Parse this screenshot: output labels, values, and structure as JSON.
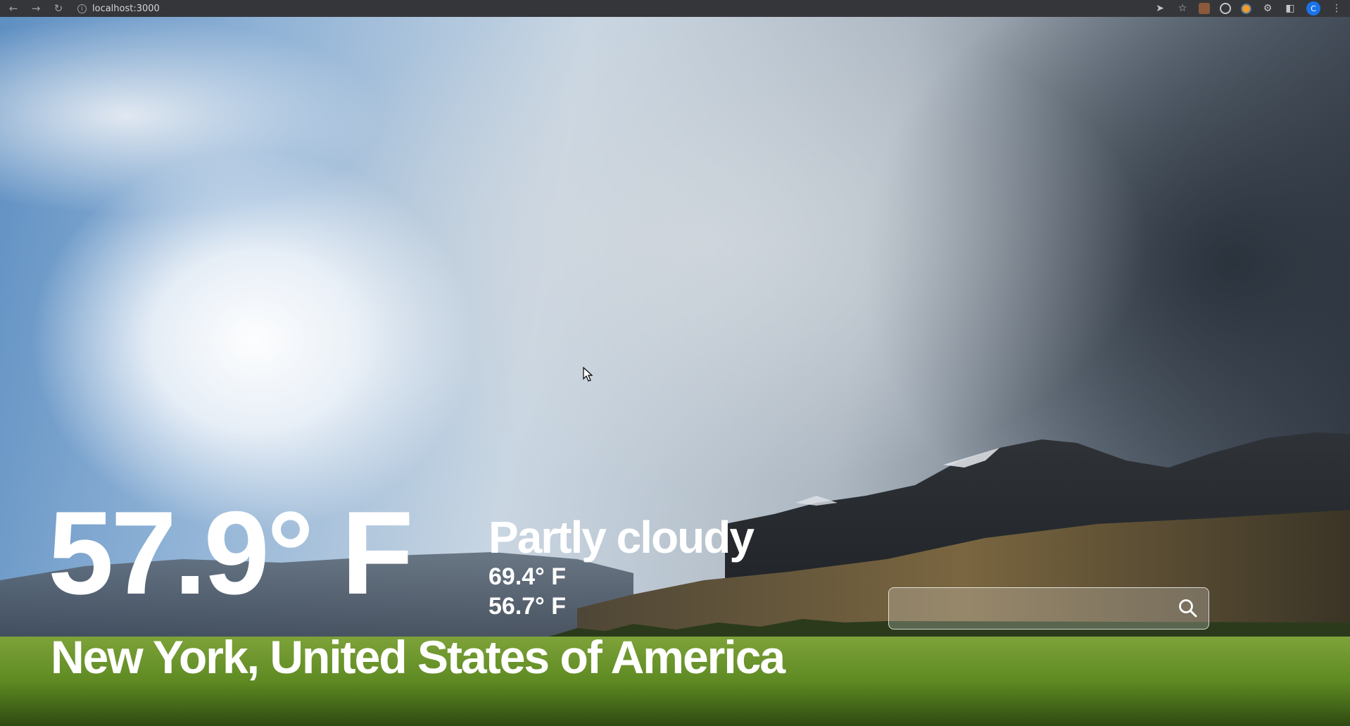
{
  "browser": {
    "url": "localhost:3000",
    "avatar_letter": "C",
    "icons": [
      "back-icon",
      "forward-icon",
      "reload-icon",
      "info-icon",
      "send-icon",
      "star-icon",
      "extension-icon",
      "puzzle-icon",
      "sidebar-icon",
      "menu-icon"
    ]
  },
  "weather": {
    "temperature": "57.9° F",
    "condition": "Partly cloudy",
    "high": "69.4° F",
    "low": "56.7° F",
    "location": "New York, United States of America"
  },
  "search": {
    "value": "",
    "placeholder": ""
  },
  "colors": {
    "text": "#ffffff",
    "chrome": "#35363a",
    "avatar": "#1a73e8"
  }
}
